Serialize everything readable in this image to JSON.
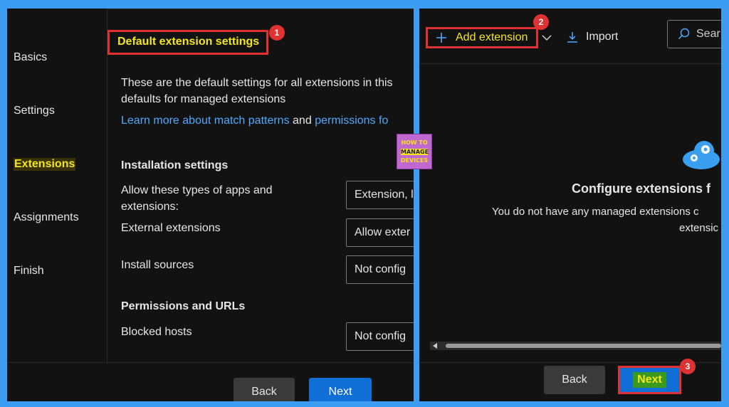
{
  "left": {
    "nav": [
      {
        "label": "Basics",
        "active": false
      },
      {
        "label": "Settings",
        "active": false
      },
      {
        "label": "Extensions",
        "active": true
      },
      {
        "label": "Assignments",
        "active": false
      },
      {
        "label": "Finish",
        "active": false
      }
    ],
    "heading": "Default extension settings",
    "heading_badge": "1",
    "desc_line1": "These are the default settings for all extensions in this",
    "desc_line2": "defaults for managed extensions",
    "link1": "Learn more about match patterns",
    "and_text": "and",
    "link2": "permissions fo",
    "install_heading": "Installation settings",
    "allow_label_1": "Allow these types of apps and",
    "allow_label_2": "extensions:",
    "allow_value": "Extension, l",
    "external_label": "External extensions",
    "external_value": "Allow exter",
    "sources_label": "Install sources",
    "sources_value": "Not config",
    "perm_heading": "Permissions and URLs",
    "blocked_label": "Blocked hosts",
    "blocked_value": "Not config",
    "back_label": "Back",
    "next_label": "Next"
  },
  "right": {
    "add_label": "Add extension",
    "add_badge": "2",
    "import_label": "Import",
    "search_label": "Sear",
    "empty_title": "Configure extensions f",
    "empty_line1": "You do not have any managed extensions c",
    "empty_line2": "extensic",
    "back_label": "Back",
    "next_label": "Next",
    "next_badge": "3"
  },
  "logo": {
    "line1": "HOW TO",
    "line2": "MANAGE",
    "line3": "DEVICES"
  },
  "colors": {
    "frame": "#3d9df2",
    "background": "#121212",
    "highlight_text": "#f3e61a",
    "annotation_red": "#e03232",
    "link": "#4fa9ff",
    "primary_button": "#0f6fd6",
    "next_highlight": "#3a9a1e"
  },
  "icons": [
    "plus-icon",
    "chevron-down-icon",
    "download-icon",
    "search-icon",
    "cloud-gear-icon"
  ]
}
